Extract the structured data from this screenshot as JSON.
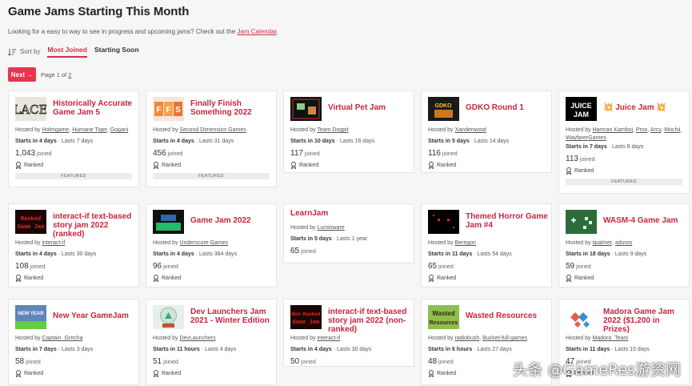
{
  "page": {
    "title": "Game Jams Starting This Month",
    "intro_text": "Looking for a easy to way to see in progress and upcoming jams? Check out the",
    "intro_link": "Jam Calendar",
    "intro_end": "."
  },
  "sort": {
    "label": "Sort by",
    "most_joined": "Most Joined",
    "starting_soon": "Starting Soon"
  },
  "pager": {
    "next_label": "Next →",
    "page_of": "Page 1 of",
    "total_pages": "2"
  },
  "labels": {
    "hosted_by": "Hosted by",
    "joined": "joined",
    "ranked": "Ranked",
    "featured": "FEATURED",
    "starts": "Starts in",
    "lasts": "Lasts"
  },
  "jams": [
    {
      "title": "Historically Accurate Game Jam 5",
      "hosts": [
        "Holmgame",
        "Humane Tiger",
        "Gogani"
      ],
      "starts": "4 days",
      "lasts": "7 days",
      "joined": "1,043",
      "ranked": true,
      "featured": true,
      "thumb_icon": "lace-thumbnail"
    },
    {
      "title": "Finally Finish Something 2022",
      "hosts": [
        "Second Dimension Games"
      ],
      "starts": "4 days",
      "lasts": "31 days",
      "joined": "456",
      "ranked": true,
      "featured": true,
      "thumb_icon": "ffs-thumbnail"
    },
    {
      "title": "Virtual Pet Jam",
      "hosts": [
        "Team Dogpit"
      ],
      "starts": "10 days",
      "lasts": "16 days",
      "joined": "117",
      "ranked": true,
      "featured": false,
      "thumb_icon": "virtual-pet-thumbnail"
    },
    {
      "title": "GDKO Round 1",
      "hosts": [
        "Xanderwood"
      ],
      "starts": "5 days",
      "lasts": "14 days",
      "joined": "116",
      "ranked": true,
      "featured": false,
      "thumb_icon": "gdko-thumbnail"
    },
    {
      "title": "💥 Juice Jam 💥",
      "hosts": [
        "Harman Kamboj",
        "Prox",
        "Arcy",
        "Mochii",
        "WayfarerGames"
      ],
      "starts": "7 days",
      "lasts": "8 days",
      "joined": "113",
      "ranked": true,
      "featured": true,
      "thumb_icon": "juice-jam-thumbnail"
    },
    {
      "title": "interact-if text-based story jam 2022 (ranked)",
      "hosts": [
        "interact-if"
      ],
      "starts": "4 days",
      "lasts": "30 days",
      "joined": "108",
      "ranked": true,
      "featured": false,
      "thumb_icon": "ranked-game-jam-thumbnail"
    },
    {
      "title": "Game Jam 2022",
      "hosts": [
        "Underscore Games"
      ],
      "starts": "4 days",
      "lasts": "364 days",
      "joined": "96",
      "ranked": true,
      "featured": false,
      "thumb_icon": "game-jam-2022-thumbnail"
    },
    {
      "title": "LearnJam",
      "hosts": [
        "Luminware"
      ],
      "starts": "5 days",
      "lasts": "1 year",
      "joined": "65",
      "ranked": false,
      "featured": false,
      "thumb_icon": ""
    },
    {
      "title": "Themed Horror Game Jam #4",
      "hosts": [
        "Beregon"
      ],
      "starts": "11 days",
      "lasts": "54 days",
      "joined": "65",
      "ranked": true,
      "featured": false,
      "thumb_icon": "horror-thumbnail"
    },
    {
      "title": "WASM-4 Game Jam",
      "hosts": [
        "tipalmer",
        "aduros"
      ],
      "starts": "18 days",
      "lasts": "9 days",
      "joined": "59",
      "ranked": true,
      "featured": false,
      "thumb_icon": "wasm4-thumbnail"
    },
    {
      "title": "New Year GameJam",
      "hosts": [
        "Captain_Grecha"
      ],
      "starts": "7 days",
      "lasts": "3 days",
      "joined": "58",
      "ranked": true,
      "featured": false,
      "thumb_icon": "new-year-thumbnail"
    },
    {
      "title": "Dev Launchers Jam 2021 - Winter Edition",
      "hosts": [
        "DevLaunchers"
      ],
      "starts": "11 hours",
      "lasts": "4 days",
      "joined": "51",
      "ranked": true,
      "featured": false,
      "thumb_icon": "snowglobe-thumbnail"
    },
    {
      "title": "interact-if text-based story jam 2022 (non-ranked)",
      "hosts": [
        "interact-if"
      ],
      "starts": "4 days",
      "lasts": "30 days",
      "joined": "50",
      "ranked": false,
      "featured": false,
      "thumb_icon": "non-ranked-game-jam-thumbnail"
    },
    {
      "title": "Wasted Resources",
      "hosts": [
        "radiobush",
        "Bucket-full-games"
      ],
      "starts": "6 hours",
      "lasts": "27 days",
      "joined": "48",
      "ranked": true,
      "featured": false,
      "thumb_icon": "wasted-resources-thumbnail"
    },
    {
      "title": "Madora Game Jam 2022 ($1,200 in Prizes)",
      "hosts": [
        "Madora_Team"
      ],
      "starts": "11 days",
      "lasts": "15 days",
      "joined": "47",
      "ranked": true,
      "featured": false,
      "thumb_icon": "madora-thumbnail"
    }
  ],
  "watermark": "头条 @GameRes游资网"
}
